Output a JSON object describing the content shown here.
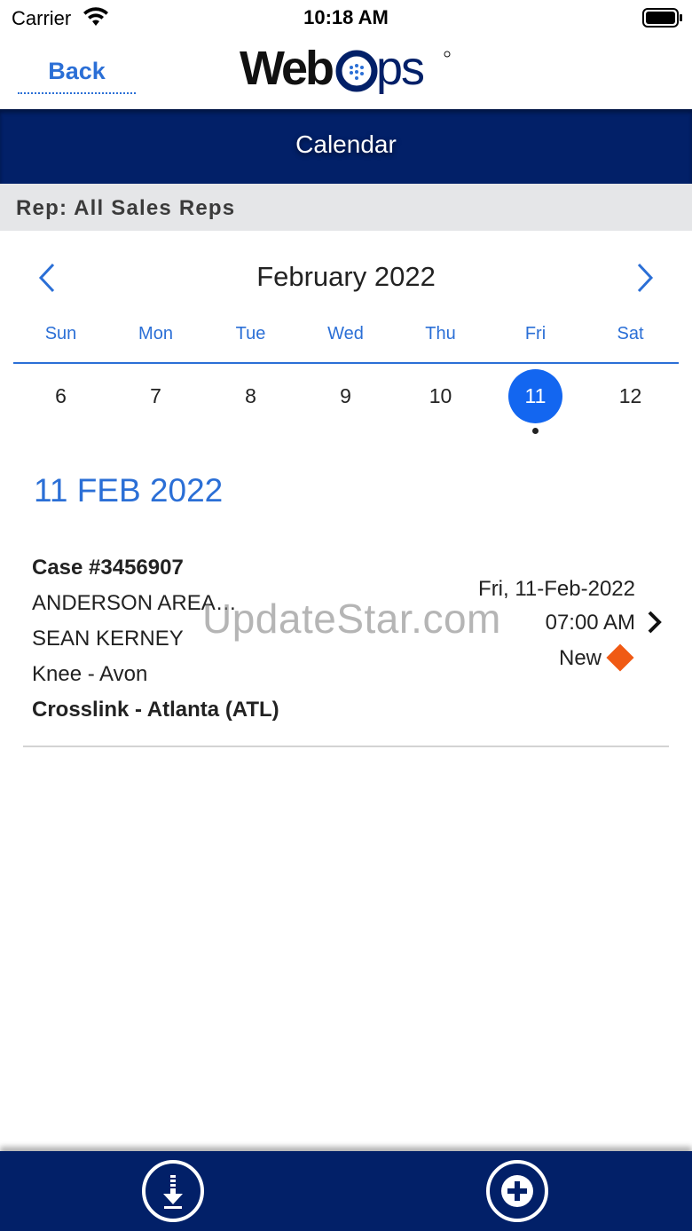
{
  "status_bar": {
    "carrier": "Carrier",
    "time": "10:18 AM"
  },
  "header": {
    "back_label": "Back",
    "logo_text": "WebOps"
  },
  "title_bar": {
    "title": "Calendar"
  },
  "rep_bar": {
    "label": "Rep: All Sales Reps"
  },
  "calendar": {
    "month_label": "February 2022",
    "weekdays": [
      "Sun",
      "Mon",
      "Tue",
      "Wed",
      "Thu",
      "Fri",
      "Sat"
    ],
    "days": [
      "6",
      "7",
      "8",
      "9",
      "10",
      "11",
      "12"
    ],
    "selected_day": "11"
  },
  "selected_date_heading": "11 FEB 2022",
  "case": {
    "case_number": "Case #3456907",
    "facility": "ANDERSON AREA…",
    "surgeon": "SEAN KERNEY",
    "procedure": "Knee - Avon",
    "location": "Crosslink - Atlanta (ATL)",
    "date": "Fri, 11-Feb-2022",
    "time": "07:00 AM",
    "status": "New",
    "status_color": "#f05a14"
  },
  "watermark": "UpdateStar.com",
  "colors": {
    "accent": "#2b6fd6",
    "navy": "#022068",
    "selected": "#1366f0"
  },
  "bottom_bar": {
    "icons": [
      "download-icon",
      "add-icon"
    ]
  }
}
